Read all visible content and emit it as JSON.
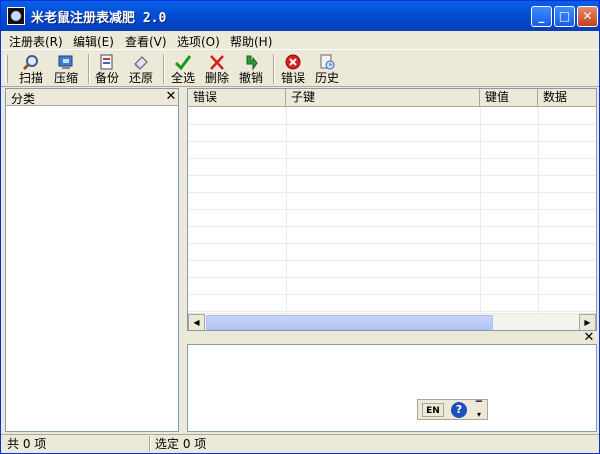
{
  "window": {
    "title": "米老鼠注册表减肥 2.0"
  },
  "menu": [
    "注册表(R)",
    "编辑(E)",
    "查看(V)",
    "选项(O)",
    "帮助(H)"
  ],
  "toolbar": [
    {
      "label": "扫描",
      "icon": "magnifier-icon"
    },
    {
      "label": "压缩",
      "icon": "compress-icon"
    },
    {
      "label": "备份",
      "icon": "backup-icon"
    },
    {
      "label": "还原",
      "icon": "restore-icon"
    },
    {
      "label": "全选",
      "icon": "checkmark-icon"
    },
    {
      "label": "删除",
      "icon": "delete-x-icon"
    },
    {
      "label": "撤销",
      "icon": "undo-arrow-icon"
    },
    {
      "label": "错误",
      "icon": "error-icon"
    },
    {
      "label": "历史",
      "icon": "history-icon"
    }
  ],
  "left_panel": {
    "title": "分类"
  },
  "list": {
    "columns": [
      "错误",
      "子键",
      "键值",
      "数据"
    ]
  },
  "ime": {
    "lang": "EN"
  },
  "status": {
    "total": "共 0 项",
    "selected": "选定 0 项"
  }
}
